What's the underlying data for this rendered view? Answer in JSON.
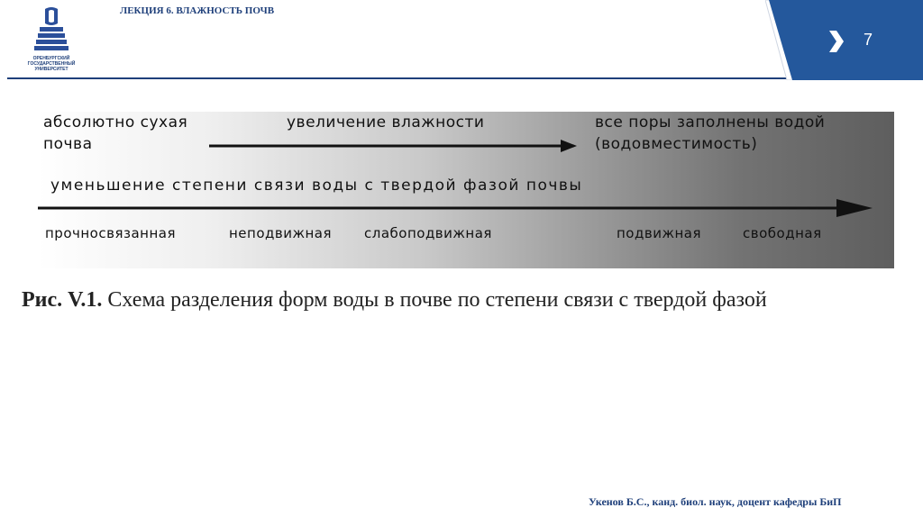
{
  "header": {
    "logo_text": [
      "ОРЕНБУРГСКИЙ",
      "ГОСУДАРСТВЕННЫЙ",
      "УНИВЕРСИТЕТ"
    ],
    "title": "ЛЕКЦИЯ 6. ВЛАЖНОСТЬ ПОЧВ",
    "page_number": "7",
    "accent_color": "#1e4f8f"
  },
  "figure": {
    "row1": {
      "left_line1": "абсолютно сухая",
      "left_line2": "почва",
      "middle": "увеличение  влажности",
      "right_line1": "все поры заполнены  водой",
      "right_line2": "(водовместимость)"
    },
    "row2": "уменьшение степени связи  воды с твердой  фазой почвы",
    "row3": {
      "item1": "прочносвязанная",
      "item2": "неподвижная",
      "item3": "слабоподвижная",
      "item4": "подвижная",
      "item5": "свободная"
    }
  },
  "caption": {
    "label": "Рис. V.1.",
    "text": "Схема разделения форм воды в почве по степени связи с твердой фазой"
  },
  "footer": "Укенов Б.С., канд. биол. наук, доцент кафедры БиП"
}
